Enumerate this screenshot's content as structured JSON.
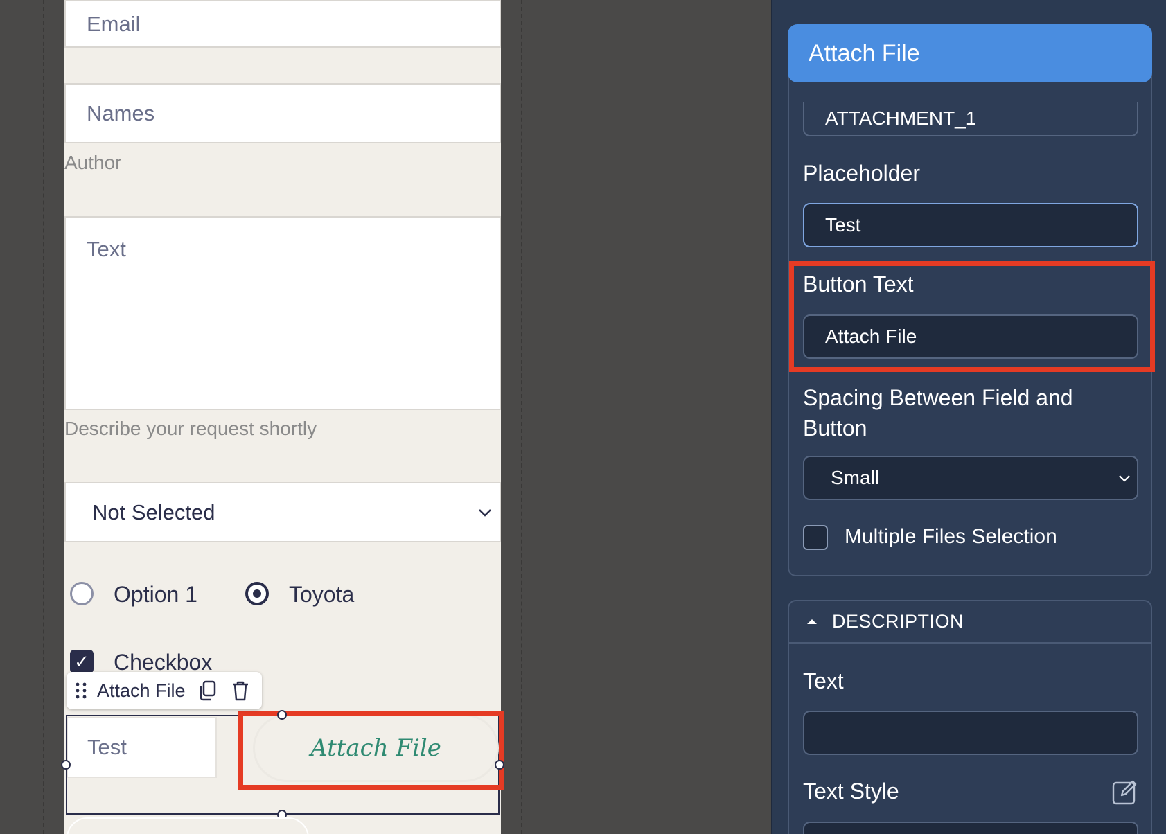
{
  "form": {
    "email_placeholder": "Email",
    "names_placeholder": "Names",
    "author_helper": "Author",
    "text_placeholder": "Text",
    "text_helper": "Describe your request shortly",
    "select_value": "Not Selected",
    "radio_options": [
      {
        "label": "Option 1",
        "selected": false
      },
      {
        "label": "Toyota",
        "selected": true
      }
    ],
    "checkbox_label": "Checkbox",
    "checkbox_checked": true,
    "attach_field_placeholder": "Test",
    "attach_button_label": "Attach File"
  },
  "toolbar": {
    "element_label": "Attach File",
    "icons": [
      "drag-handle-icon",
      "duplicate-icon",
      "trash-icon"
    ]
  },
  "panel": {
    "title": "Attach File",
    "field_name_value": "ATTACHMENT_1",
    "placeholder_label": "Placeholder",
    "placeholder_value": "Test",
    "button_text_label": "Button Text",
    "button_text_value": "Attach File",
    "spacing_label_line1": "Spacing Between Field and",
    "spacing_label_line2": "Button",
    "spacing_value": "Small",
    "multiple_files_label": "Multiple Files Selection",
    "multiple_files_checked": false,
    "description_header": "DESCRIPTION",
    "desc_text_label": "Text",
    "desc_text_value": "",
    "text_style_label": "Text Style"
  },
  "colors": {
    "canvas_bg": "#4a4948",
    "form_bg": "#f2efe9",
    "panel_bg": "#2b3a52",
    "panel_header_bg": "#4a8de0",
    "attach_button_text": "#2f8a72",
    "highlight": "#e53b24"
  }
}
